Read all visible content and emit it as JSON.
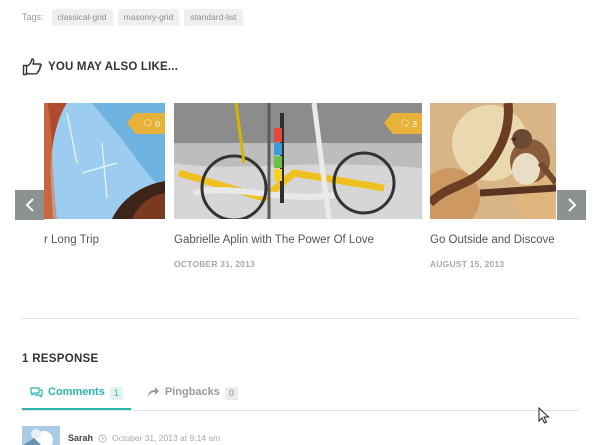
{
  "tags": {
    "label": "Tags:",
    "items": [
      "classical-grid",
      "masonry-grid",
      "standard-list"
    ]
  },
  "related": {
    "heading": "YOU MAY ALSO LIKE...",
    "heading_icon": "thumbs-up-pointing-icon",
    "posts": [
      {
        "title": "r Long Trip",
        "date": "",
        "comment_count": "0",
        "image": "arch-sky-photo"
      },
      {
        "title": "Gabrielle Aplin with The Power Of Love",
        "date": "OCTOBER 31, 2013",
        "comment_count": "3",
        "image": "bicycle-photo"
      },
      {
        "title": "Go Outside and Discove",
        "date": "AUGUST 15, 2013",
        "comment_count": "",
        "image": "sparrow-photo"
      }
    ],
    "prev_icon": "chevron-left-icon",
    "next_icon": "chevron-right-icon"
  },
  "responses": {
    "title": "1 RESPONSE",
    "tabs": [
      {
        "label": "Comments",
        "count": "1",
        "icon": "comments-icon",
        "active": true
      },
      {
        "label": "Pingbacks",
        "count": "0",
        "icon": "share-arrow-icon",
        "active": false
      }
    ],
    "comments": [
      {
        "author": "Sarah",
        "time": "October 31, 2013 at 9:14 am",
        "time_icon": "clock-icon"
      }
    ]
  },
  "colors": {
    "accent": "#2bb5b0",
    "badge": "#e8b13a",
    "nav_button": "#8b9291"
  }
}
